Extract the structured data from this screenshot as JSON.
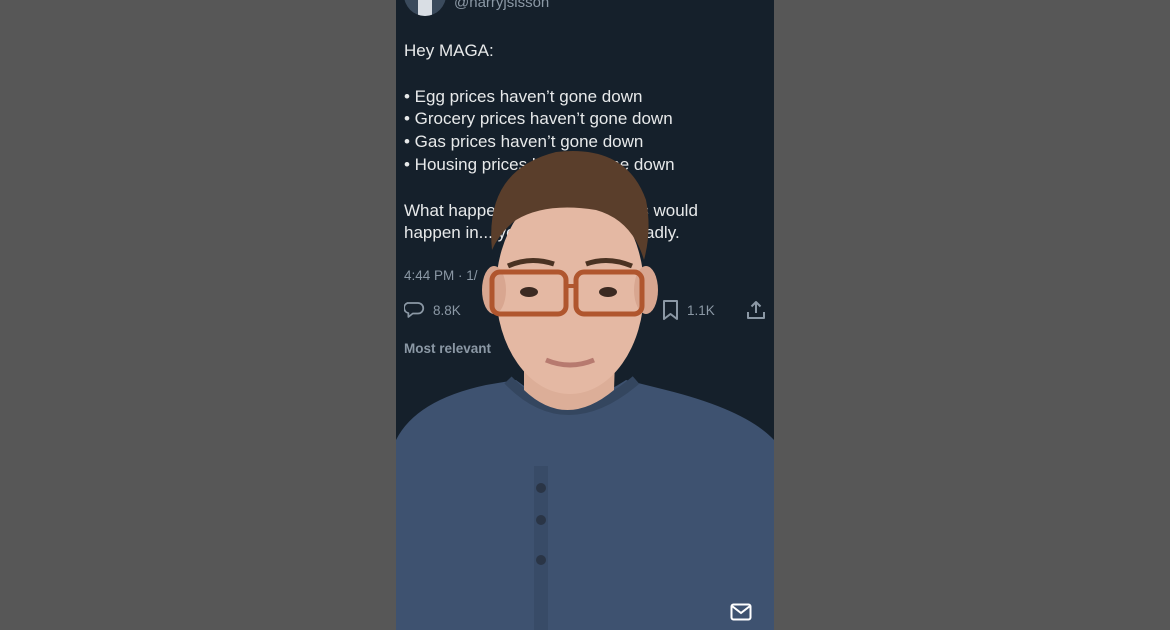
{
  "tweet": {
    "handle": "@harryjsisson",
    "intro": "Hey MAGA:",
    "bullets": [
      "• Egg prices haven’t gone down",
      "• Grocery prices haven’t gone down",
      "• Gas prices haven’t gone down",
      "• Housing prices haven’t gone down"
    ],
    "closing_line1": "What happened? Who knew this would",
    "closing_line2": "happen in... you got played so badly.",
    "timestamp": "4:44 PM · 1/",
    "replies": "8.8K",
    "bookmarks": "1.1K",
    "sort_label": "Most relevant"
  },
  "icons": {
    "reply": "speech-bubble-icon",
    "bookmark": "bookmark-icon",
    "share": "share-upload-icon",
    "messages": "envelope-icon"
  },
  "colors": {
    "background": "#575757",
    "tweet_bg": "#15202b",
    "text": "#e7e9ea",
    "muted": "#8b98a5",
    "shirt": "#3e5270",
    "skin": "#e4b8a3",
    "hair": "#5a3e2b",
    "glasses": "#b0562e"
  }
}
